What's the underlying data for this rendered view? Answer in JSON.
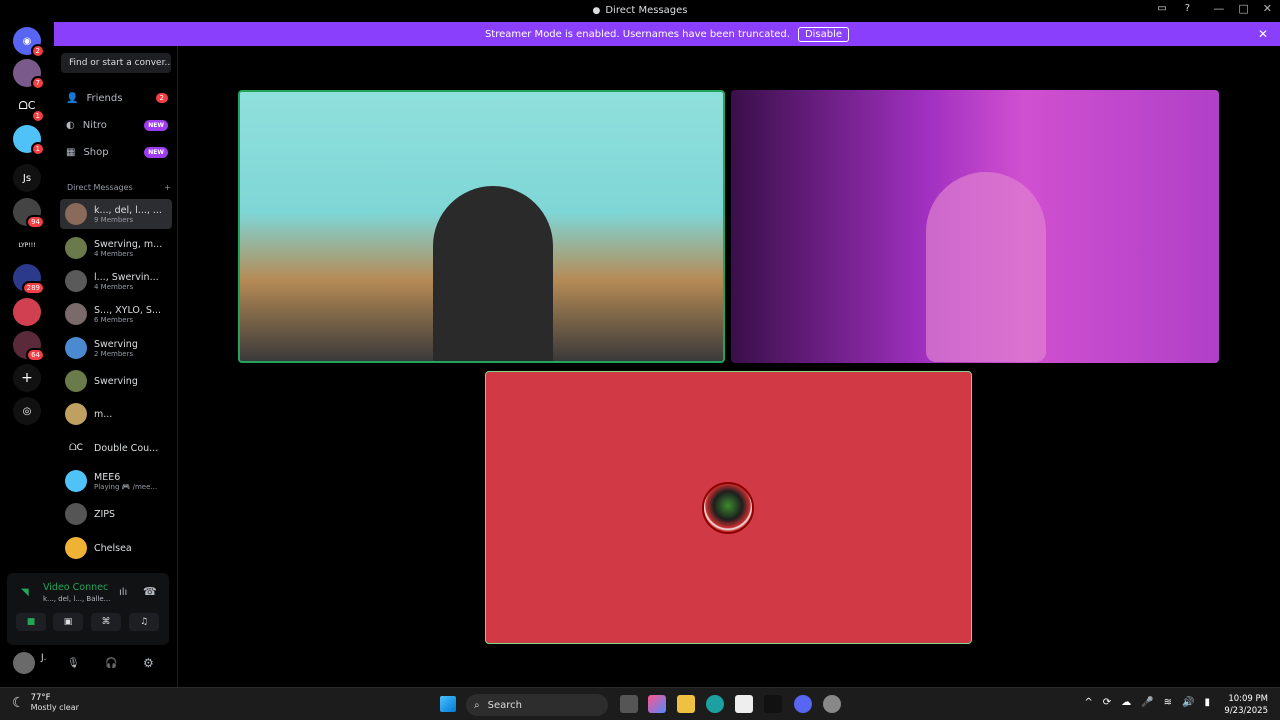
{
  "window": {
    "title": "Direct Messages"
  },
  "banner": {
    "text": "Streamer Mode is enabled. Usernames have been truncated.",
    "disable_label": "Disable"
  },
  "guilds": [
    {
      "label": "",
      "badge": "2",
      "color": "#5865f2"
    },
    {
      "label": "",
      "badge": "7",
      "color": "#7a5a8a"
    },
    {
      "label": "",
      "badge": "1",
      "color": "#000000"
    },
    {
      "label": "",
      "badge": "1",
      "color": "#4fc3f7"
    },
    {
      "label": "Js",
      "badge": "",
      "color": "#111111"
    },
    {
      "label": "",
      "badge": "94",
      "color": "#444444"
    },
    {
      "label": "LYP!!!",
      "badge": "",
      "color": "#000000"
    },
    {
      "label": "",
      "badge": "289",
      "color": "#2b3a8a"
    },
    {
      "label": "",
      "badge": "",
      "color": "#d04050"
    },
    {
      "label": "",
      "badge": "64",
      "color": "#5a2a3a"
    }
  ],
  "sidebar": {
    "search_placeholder": "Find or start a conver...",
    "nav": [
      {
        "label": "Friends",
        "badge": "2"
      },
      {
        "label": "Nitro",
        "tag": "NEW"
      },
      {
        "label": "Shop",
        "tag": "NEW"
      }
    ],
    "dm_header": "Direct Messages",
    "dms": [
      {
        "name": "k..., del, l..., ...",
        "sub": "9 Members",
        "color": "#8a6a5a"
      },
      {
        "name": "Swerving, m...",
        "sub": "4 Members",
        "color": "#6a7a4a"
      },
      {
        "name": "l..., Swervin...",
        "sub": "4 Members",
        "color": "#5a5a5a"
      },
      {
        "name": "S..., XYLO, S...",
        "sub": "6 Members",
        "color": "#7a6a6a"
      },
      {
        "name": "Swerving",
        "sub": "2 Members",
        "color": "#4a8ad0"
      },
      {
        "name": "Swerving",
        "sub": "",
        "color": "#6a7a4a"
      },
      {
        "name": "m...",
        "sub": "",
        "color": "#c0a060"
      },
      {
        "name": "Double Cou...",
        "sub": "",
        "color": "#000000"
      },
      {
        "name": "MEE6",
        "sub": "Playing 🎮 /mee...",
        "color": "#4fc3f7"
      },
      {
        "name": "ZIPS",
        "sub": "",
        "color": "#555555"
      },
      {
        "name": "Chelsea",
        "sub": "",
        "color": "#f0b232"
      }
    ]
  },
  "voice": {
    "title": "Video Connec",
    "sub": "k..., del, l..., Balle..."
  },
  "user": {
    "name": "J."
  },
  "taskbar": {
    "temp": "77°F",
    "condition": "Mostly clear",
    "search_label": "Search",
    "time": "10:09 PM",
    "date": "9/23/2025"
  }
}
